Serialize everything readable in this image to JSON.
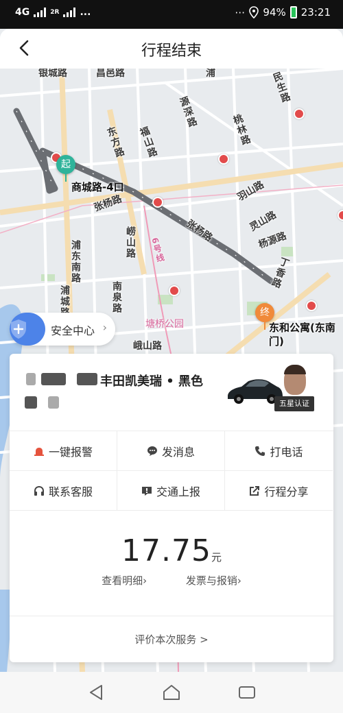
{
  "status": {
    "network": "4G",
    "sim1": "1",
    "sim2": "2R",
    "dots": "...",
    "battery": "94%",
    "time": "23:21"
  },
  "header": {
    "title": "行程结束"
  },
  "map": {
    "roads": {
      "changyi": "昌邑路",
      "pujian": "浦",
      "dongfang": "东方路",
      "fushan": "福山路",
      "yuanshen": "源深路",
      "taolin": "桃林路",
      "minsheng": "民生路",
      "yushan": "羽山路",
      "lingshan": "灵山路",
      "yangyuan": "杨源路",
      "zhangyang_left": "张杨路",
      "zhangyang_right": "张杨路",
      "pudong_nan": "浦东南路",
      "laoshan": "崂山路",
      "nanquan": "南泉路",
      "pucheng": "浦城路",
      "dingxiang": "丁香路",
      "line6": "6号线",
      "tangqiao_park": "塘桥公园",
      "eshan": "峨山路",
      "gaoyin": "银城路"
    },
    "start": {
      "marker": "起",
      "label": "商城路-4口"
    },
    "end": {
      "marker": "终",
      "label": "东和公寓(东南门)"
    },
    "safety_center": "安全中心"
  },
  "card": {
    "car_desc": "丰田凯美瑞 • 黑色",
    "driver_badge": "五星认证",
    "actions": [
      {
        "label": "一键报警",
        "icon": "alarm-icon"
      },
      {
        "label": "发消息",
        "icon": "message-icon"
      },
      {
        "label": "打电话",
        "icon": "phone-icon"
      },
      {
        "label": "联系客服",
        "icon": "headset-icon"
      },
      {
        "label": "交通上报",
        "icon": "report-icon"
      },
      {
        "label": "行程分享",
        "icon": "share-icon"
      }
    ],
    "price": "17.75",
    "currency": "元",
    "detail_link": "查看明细",
    "invoice_link": "发票与报销",
    "rate_link": "评价本次服务 >"
  },
  "colors": {
    "route": "#6b6e73",
    "start_pin": "#2fb39a",
    "end_pin": "#f08a3a",
    "shield": "#4d83e8",
    "alarm": "#e5533d"
  }
}
